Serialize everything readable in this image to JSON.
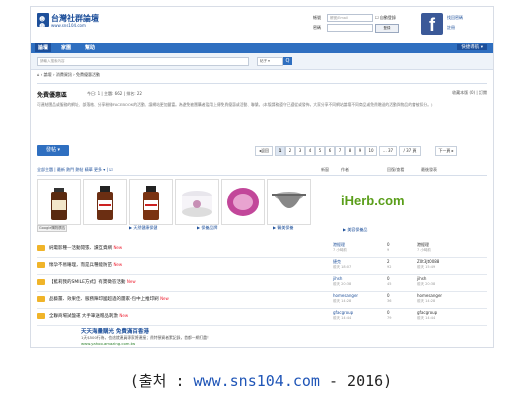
{
  "header": {
    "logo_title": "台灣社群論壇",
    "logo_sub": "www.sns104.com",
    "login_account_label": "帳號",
    "login_account_placeholder": "帳號/Email",
    "login_password_label": "密碼",
    "login_autologin": "自動登錄",
    "login_button": "登錄",
    "forgot_password": "找回密碼",
    "register": "註冊",
    "facebook_icon": "f"
  },
  "nav": {
    "items": [
      "論壇",
      "家園",
      "幫助"
    ],
    "right": "快捷導航 ▾"
  },
  "search": {
    "placeholder": "請輸入搜索內容",
    "select": "帖子 ▾",
    "button": "Q"
  },
  "breadcrumb": "⌂ › 論壇 › 消費資訊 › 免費優惠活動",
  "forum": {
    "title": "免費優惠區",
    "meta": "今日: 1 | 主題: 662 | 排名: 22",
    "right": "收藏本版 (0) | 訂閱",
    "description": "可連結團品或服務的網址、部落格、分享粉絲FACEBOOK的活動、讓網站更加豐富。為避免被團購者濫用上傳免費優惠或活動、聯繫。(本版請務遵守已遵從或發佈，大家分享不同網站論壇不同商品或免費贈送的活動與物品的會被扣分。)"
  },
  "toolbar": {
    "post_button": "發帖 ▾",
    "pages": [
      "◂返回",
      "1",
      "2",
      "3",
      "4",
      "5",
      "6",
      "7",
      "8",
      "9",
      "10",
      "... 37",
      "/ 37 頁",
      "下一頁 ▸"
    ]
  },
  "filter": {
    "left": "全部主題 | 最新 熱門 熱帖 精華 更多 ▾ | ☑",
    "col_new": "新窗",
    "col_author": "作者",
    "col_replies": "回復/查看",
    "col_last": "最後發表"
  },
  "ad": {
    "google_label": "Google購物廣告",
    "captions": [
      "▶ 天然健康保健",
      "▶ 保養品牌",
      "▶ 醫美保養",
      "▶ 美容保養品"
    ],
    "iherb": "iHerb.com"
  },
  "threads": [
    {
      "title": "純電影種—活動開張、讀互資網",
      "new": "New",
      "author": "港經理",
      "author_time": "7 小時前",
      "replies": "0",
      "views": "9",
      "last": "港經理",
      "last_time": "7 小時前"
    },
    {
      "title": "懷孕不易睡理，而是兵種能防苗",
      "new": "New",
      "author": "捷克",
      "author_time": "前天 18:07",
      "replies": "2",
      "views": "92",
      "last": "Z0t3Jt0088",
      "last_time": "前天 15:49"
    },
    {
      "title": "【藍莉我的SMILE方式】有獎徵答活動",
      "new": "New",
      "author": "jihsh",
      "author_time": "前天 20:38",
      "replies": "0",
      "views": "45",
      "last": "jihsh",
      "last_time": "前天 20:38"
    },
    {
      "title": "品藝薑、效果佳、服務陣印國超過的團家-包中上推印刷",
      "new": "New",
      "author": "homesanger",
      "author_time": "前天 14:28",
      "replies": "0",
      "views": "36",
      "last": "homesanger",
      "last_time": "前天 14:28"
    },
    {
      "title": "全聯商場試盤運 大手筆送贈品刺激",
      "new": "New",
      "author": "gfacgroup",
      "author_time": "前天 14:44",
      "replies": "0",
      "views": "79",
      "last": "gfacgroup",
      "last_time": "前天 14:44"
    }
  ],
  "bottom_ad": {
    "line1": "天天海量購光 免費滿百香港",
    "line2": "1天$500行為，也這就連員專家將連接；費特預資者累記錄，首都一網打盡！",
    "line3": "www.yahoo.amazing.com.tw"
  },
  "caption": {
    "prefix": "(출처 : ",
    "url": "www.sns104.com",
    "suffix": " - 2016)"
  },
  "colors": {
    "brand": "#1d4f9a",
    "nav": "#2f6fc0",
    "iherb": "#5a9e1a",
    "caption_url": "#1f55b7"
  }
}
